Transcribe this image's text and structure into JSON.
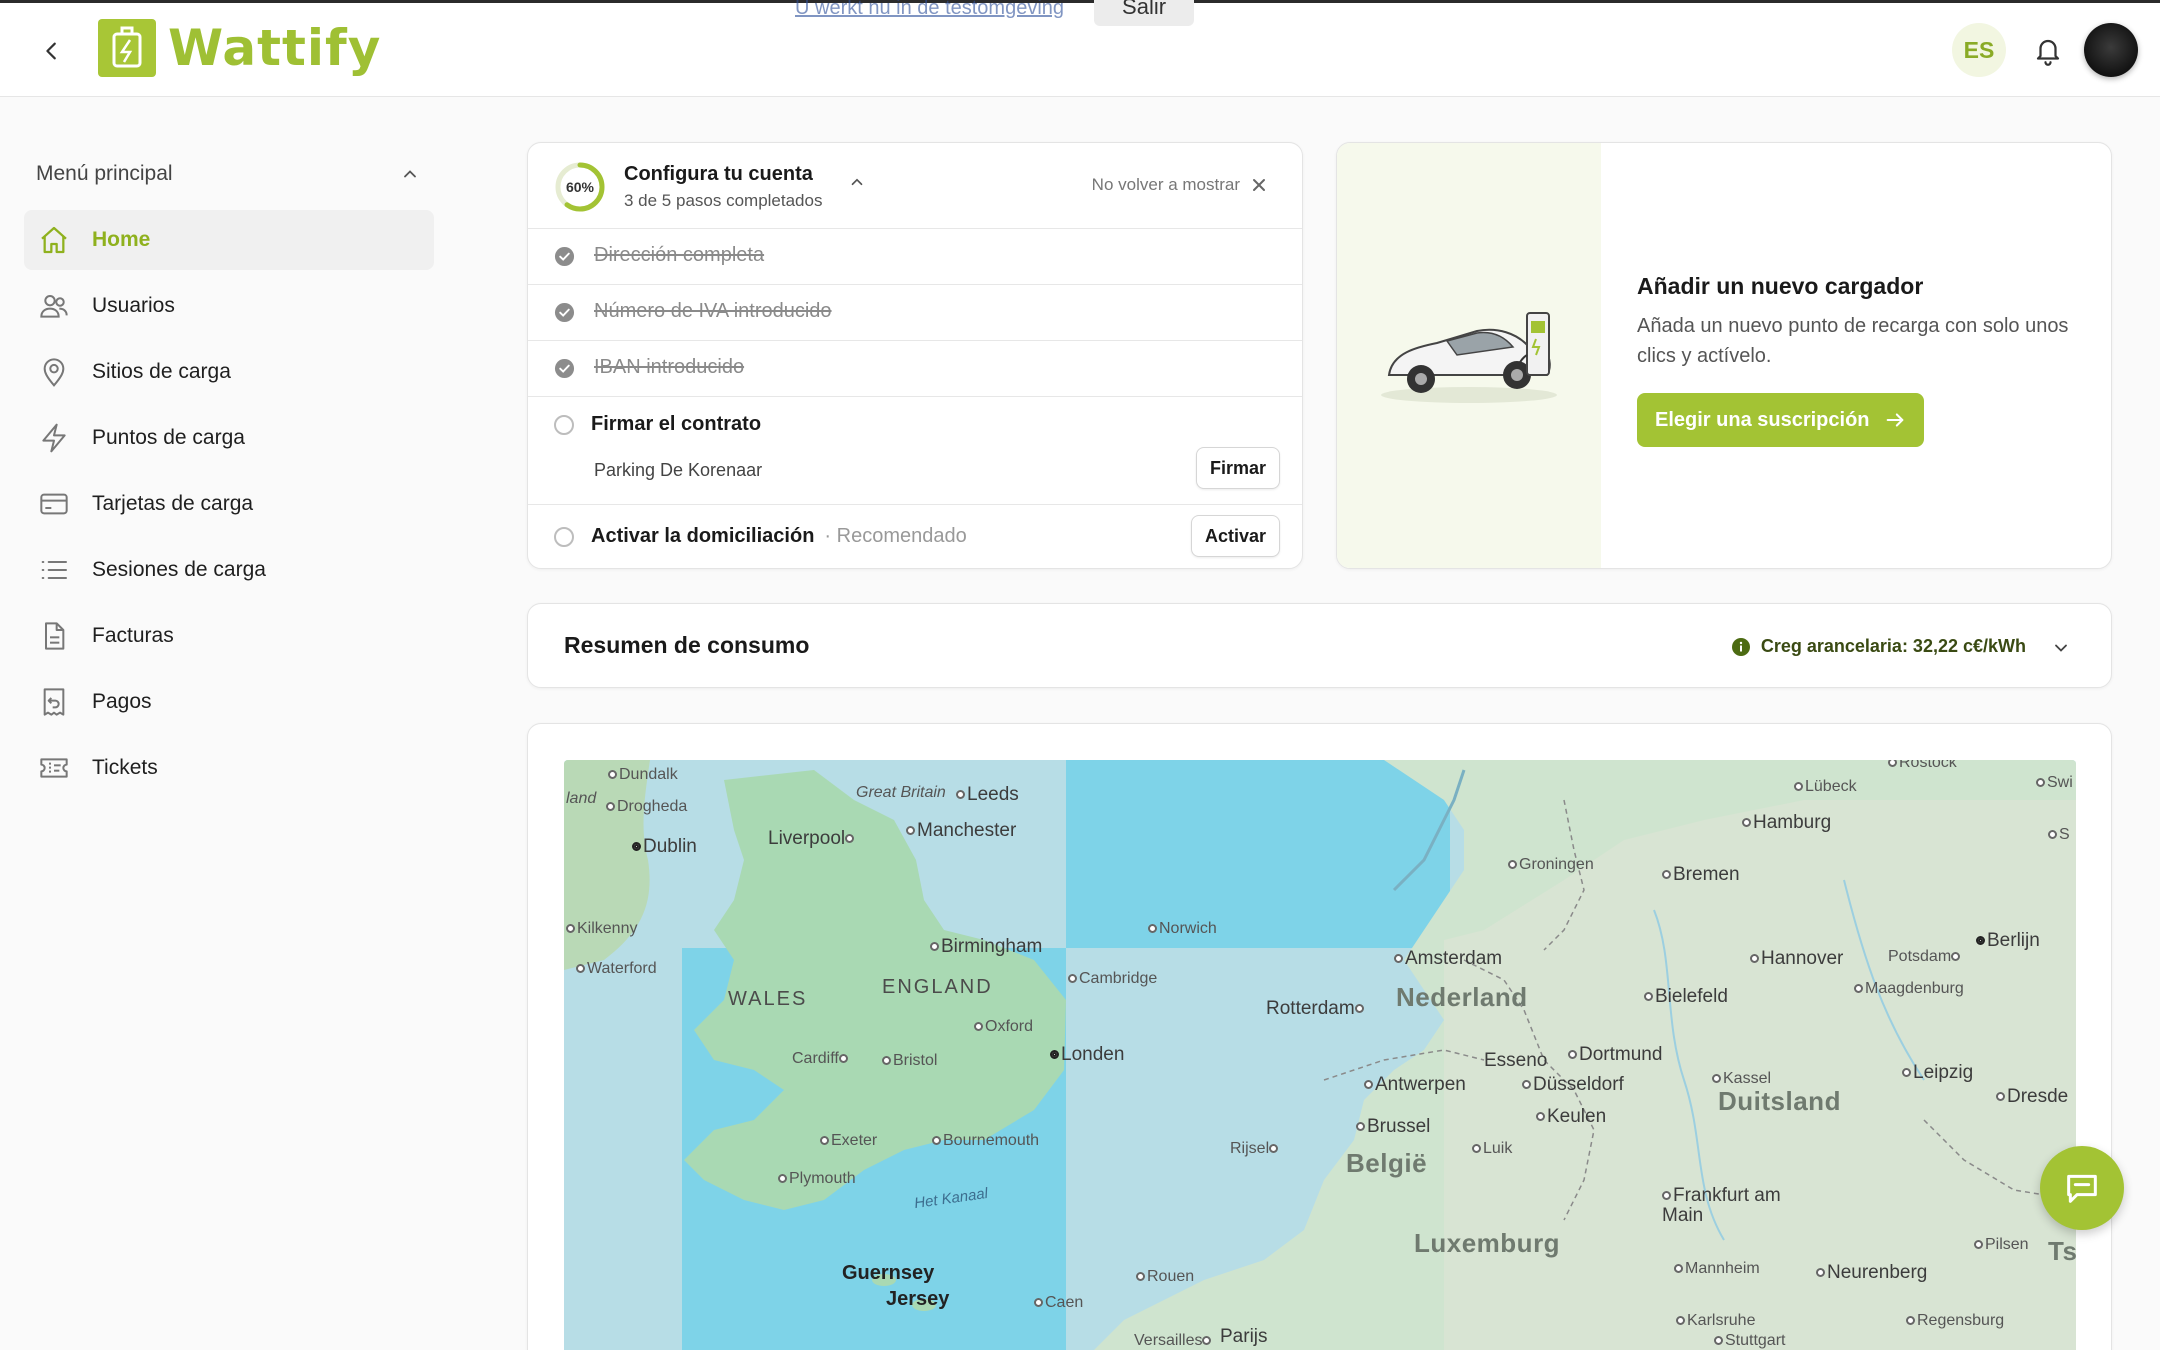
{
  "app": {
    "name": "Wattify"
  },
  "top_banner": {
    "text": "U werkt nu in de testomgeving",
    "button": "Salir"
  },
  "header": {
    "lang": "ES"
  },
  "sidebar": {
    "menu_title": "Menú principal",
    "items": [
      {
        "label": "Home",
        "icon": "home-icon",
        "active": true
      },
      {
        "label": "Usuarios",
        "icon": "users-icon"
      },
      {
        "label": "Sitios de carga",
        "icon": "map-pin-icon"
      },
      {
        "label": "Puntos de carga",
        "icon": "lightning-icon"
      },
      {
        "label": "Tarjetas de carga",
        "icon": "credit-card-icon"
      },
      {
        "label": "Sesiones de carga",
        "icon": "list-icon"
      },
      {
        "label": "Facturas",
        "icon": "document-icon"
      },
      {
        "label": "Pagos",
        "icon": "receipt-icon"
      },
      {
        "label": "Tickets",
        "icon": "ticket-icon"
      }
    ]
  },
  "onboarding": {
    "progress": "60%",
    "title": "Configura tu cuenta",
    "subtitle": "3 de 5 pasos completados",
    "dismiss": "No volver a mostrar",
    "steps": [
      {
        "label": "Dirección completa",
        "done": true
      },
      {
        "label": "Número de IVA introducido",
        "done": true
      },
      {
        "label": "IBAN introducido",
        "done": true
      },
      {
        "label": "Firmar el contrato",
        "done": false,
        "site": "Parking De Korenaar",
        "button": "Firmar"
      },
      {
        "label": "Activar la domiciliación",
        "done": false,
        "tag": "· Recomendado",
        "button": "Activar"
      }
    ]
  },
  "add_charger": {
    "title": "Añadir un nuevo cargador",
    "description": "Añada un nuevo punto de recarga con solo unos clics y actívelo.",
    "button": "Elegir una suscripción"
  },
  "summary": {
    "title": "Resumen de consumo",
    "info": "Creg arancelaria: 32,22 c€/kWh"
  },
  "map": {
    "labels": [
      "Dundalk",
      "Drogheda",
      "Dublin",
      "Kilkenny",
      "Waterford",
      "land",
      "Great Britain",
      "Leeds",
      "Liverpool",
      "Manchester",
      "Birmingham",
      "WALES",
      "ENGLAND",
      "Oxford",
      "Cardiff",
      "Bristol",
      "Londen",
      "Exeter",
      "Bournemouth",
      "Plymouth",
      "Het Kanaal",
      "Guernsey",
      "Jersey",
      "Caen",
      "Rouen",
      "Versailles",
      "Parijs",
      "Norwich",
      "Cambridge",
      "Amsterdam",
      "Nederland",
      "Rotterdam",
      "Antwerpen",
      "Esseno",
      "Dortmund",
      "Düsseldorf",
      "Keulen",
      "Brussel",
      "België",
      "Rijsel",
      "Luik",
      "Luxemburg",
      "Groningen",
      "Bremen",
      "Hamburg",
      "Lübeck",
      "Rostock",
      "Hannover",
      "Bielefeld",
      "Potsdam",
      "Berlijn",
      "Maagdenburg",
      "Kassel",
      "Leipzig",
      "Duitsland",
      "Dresde",
      "Frankfurt am Main",
      "Mannheim",
      "Karlsruhe",
      "Stuttgart",
      "Neurenberg",
      "Regensburg",
      "Pilsen",
      "Swi",
      "S",
      "Ts"
    ]
  }
}
